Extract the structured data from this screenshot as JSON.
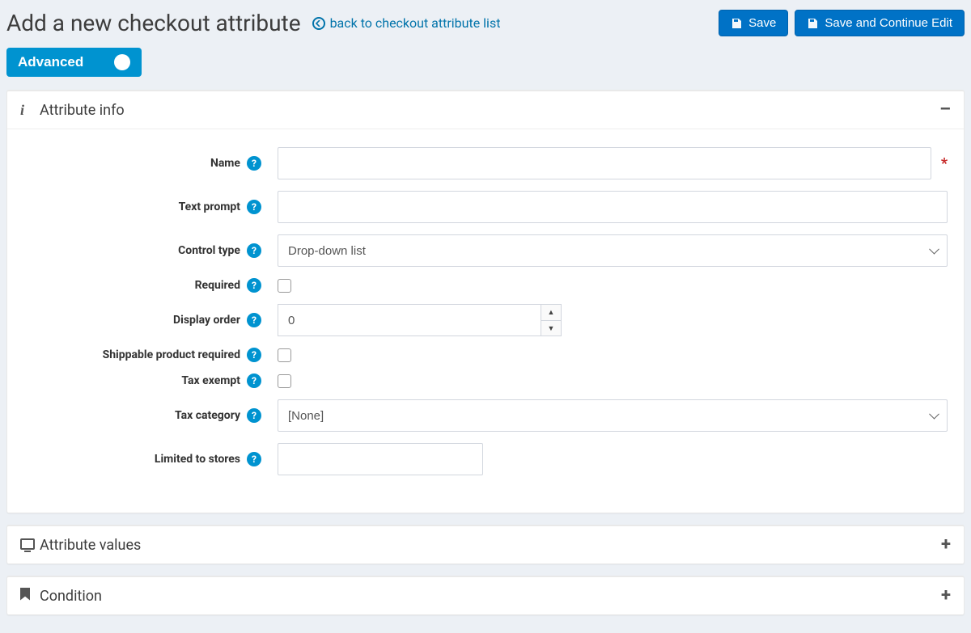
{
  "header": {
    "title": "Add a new checkout attribute",
    "back_label": "back to checkout attribute list",
    "save_label": "Save",
    "save_cont_label": "Save and Continue Edit"
  },
  "advanced_toggle": {
    "label": "Advanced",
    "state": "on"
  },
  "cards": {
    "info": {
      "title": "Attribute info",
      "collapse_symbol": "–",
      "fields": {
        "name_label": "Name",
        "name_value": "",
        "text_prompt_label": "Text prompt",
        "text_prompt_value": "",
        "control_type_label": "Control type",
        "control_type_value": "Drop-down list",
        "required_label": "Required",
        "required_checked": false,
        "display_order_label": "Display order",
        "display_order_value": "0",
        "shippable_label": "Shippable product required",
        "shippable_checked": false,
        "tax_exempt_label": "Tax exempt",
        "tax_exempt_checked": false,
        "tax_category_label": "Tax category",
        "tax_category_value": "[None]",
        "limited_stores_label": "Limited to stores",
        "limited_stores_value": ""
      }
    },
    "values": {
      "title": "Attribute values",
      "collapse_symbol": "+"
    },
    "condition": {
      "title": "Condition",
      "collapse_symbol": "+"
    }
  }
}
